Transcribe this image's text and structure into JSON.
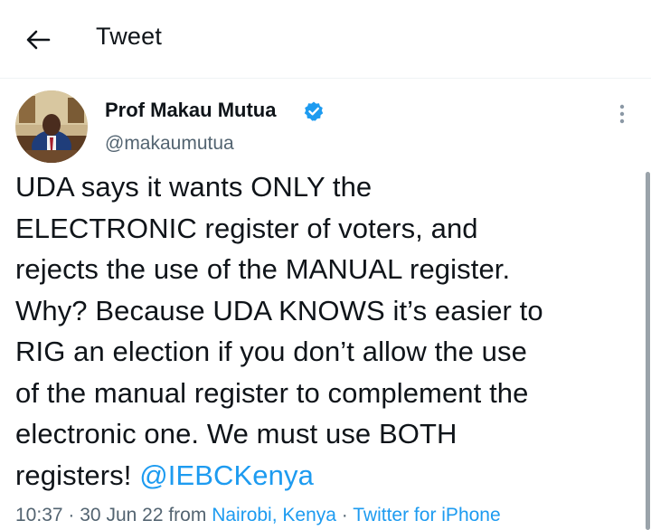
{
  "header": {
    "title": "Tweet",
    "back_icon": "arrow-left-icon"
  },
  "tweet": {
    "author_name": "Prof Makau Mutua",
    "author_handle": "@makaumutua",
    "verified_icon": "verified-badge-icon",
    "more_icon": "more-vertical-icon",
    "body": "UDA says it wants ONLY the\nELECTRONIC register of voters, and\nrejects the use of the MANUAL register.\nWhy? Because UDA KNOWS it’s easier to\nRIG an election if you don’t allow the use\nof the manual register to complement the\nelectronic one.  We must use BOTH\nregisters! ",
    "mention": "@IEBCKenya",
    "time": "10:37",
    "date": "30 Jun 22",
    "from_word": "from",
    "location": "Nairobi, Kenya",
    "separator": "·",
    "source": "Twitter for iPhone"
  },
  "colors": {
    "link": "#1d9bf0",
    "secondary_text": "#536471",
    "verified": "#1d9bf0",
    "divider": "#eff3f4"
  }
}
